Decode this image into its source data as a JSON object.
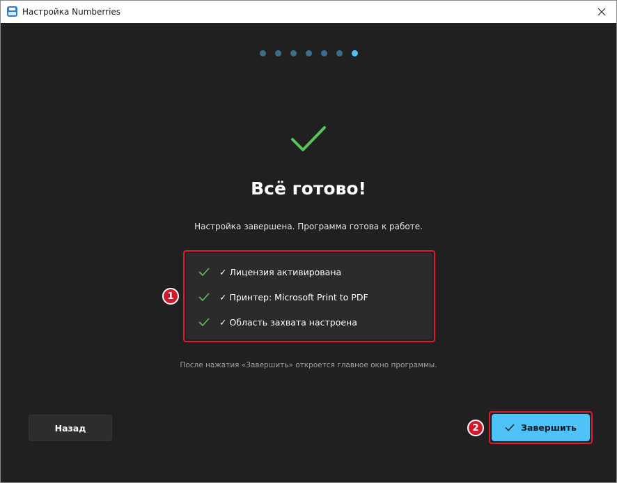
{
  "window": {
    "title": "Настройка Numberries"
  },
  "progress": {
    "total_steps": 7,
    "current_step": 7
  },
  "main": {
    "heading": "Всё готово!",
    "subtitle": "Настройка завершена. Программа готова к работе.",
    "summary": [
      "✓ Лицензия активирована",
      "✓ Принтер: Microsoft Print to PDF",
      "✓ Область захвата настроена"
    ],
    "footnote": "После нажатия «Завершить» откроется главное окно программы."
  },
  "buttons": {
    "back": "Назад",
    "finish": "Завершить"
  },
  "annotations": {
    "badge1": "1",
    "badge2": "2"
  },
  "colors": {
    "accent": "#4fc3f7",
    "success": "#5cc25c",
    "highlight": "#e0192c",
    "background": "#202020"
  },
  "icons": {
    "app": "app-icon",
    "close": "close-icon",
    "success": "check-icon",
    "finish": "check-icon"
  }
}
